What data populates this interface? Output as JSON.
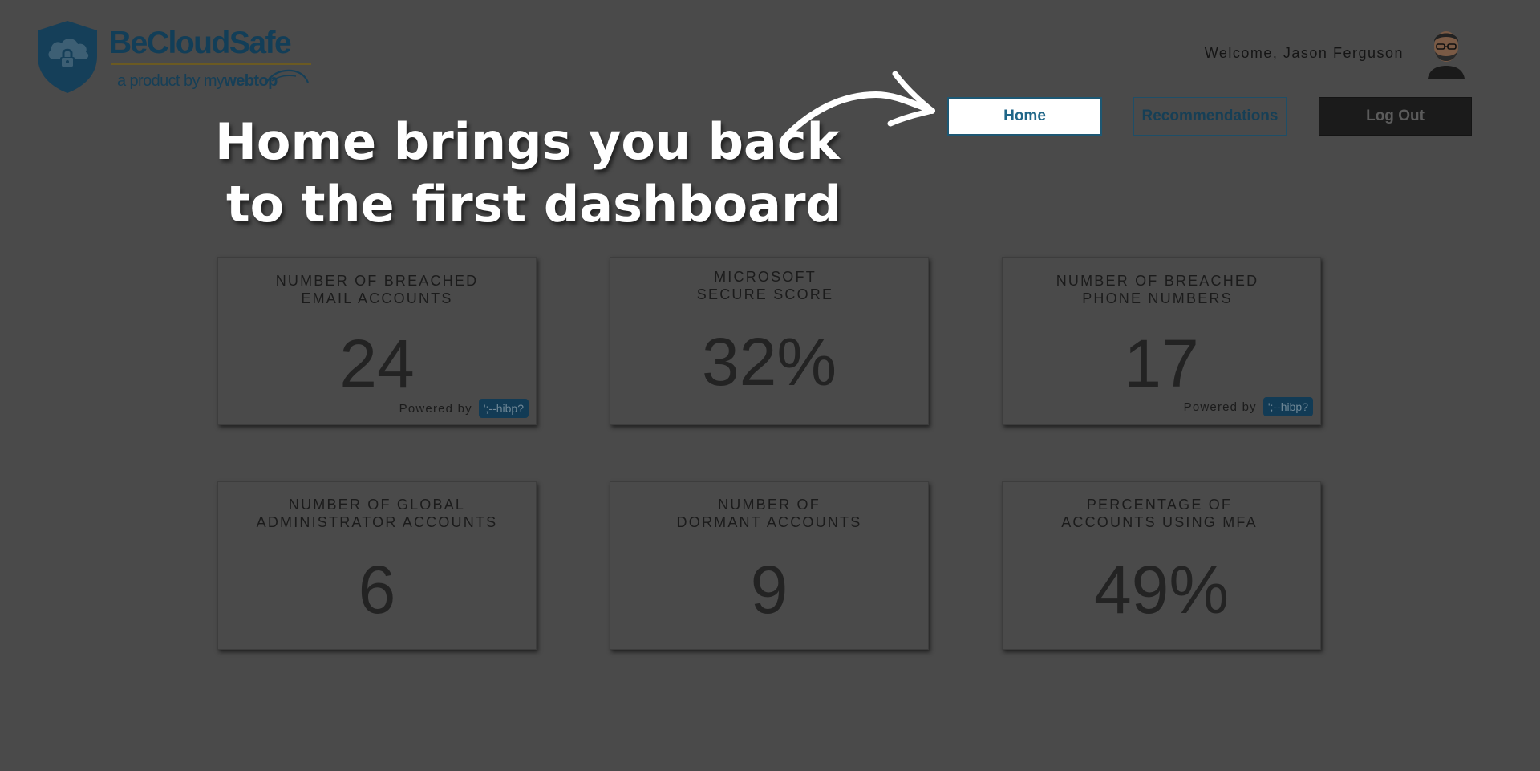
{
  "brand": {
    "name": "BeCloudSafe",
    "subtitle_prefix": "a product by ",
    "subtitle_my": "my",
    "subtitle_webtop": "webtop",
    "primary_color": "#123e58",
    "accent_color": "#6b5a22"
  },
  "header": {
    "welcome_text": "Welcome, Jason Ferguson",
    "avatar_icon": "user-avatar-icon"
  },
  "nav": {
    "home_label": "Home",
    "recommendations_label": "Recommendations",
    "logout_label": "Log Out"
  },
  "annotation": {
    "line1": "Home brings you back",
    "line2": "to the first dashboard"
  },
  "cards": [
    {
      "title_line1": "NUMBER OF BREACHED",
      "title_line2": "EMAIL ACCOUNTS",
      "value": "24",
      "powered_by": "Powered by",
      "badge": "';--hibp?"
    },
    {
      "title_line1": "MICROSOFT",
      "title_line2": "SECURE SCORE",
      "value": "32%"
    },
    {
      "title_line1": "NUMBER OF BREACHED",
      "title_line2": "PHONE NUMBERS",
      "value": "17",
      "powered_by": "Powered by",
      "badge": "';--hibp?"
    },
    {
      "title_line1": "NUMBER OF GLOBAL",
      "title_line2": "ADMINISTRATOR ACCOUNTS",
      "value": "6"
    },
    {
      "title_line1": "NUMBER OF",
      "title_line2": "DORMANT ACCOUNTS",
      "value": "9"
    },
    {
      "title_line1": "PERCENTAGE OF",
      "title_line2": "ACCOUNTS USING MFA",
      "value": "49%"
    }
  ]
}
